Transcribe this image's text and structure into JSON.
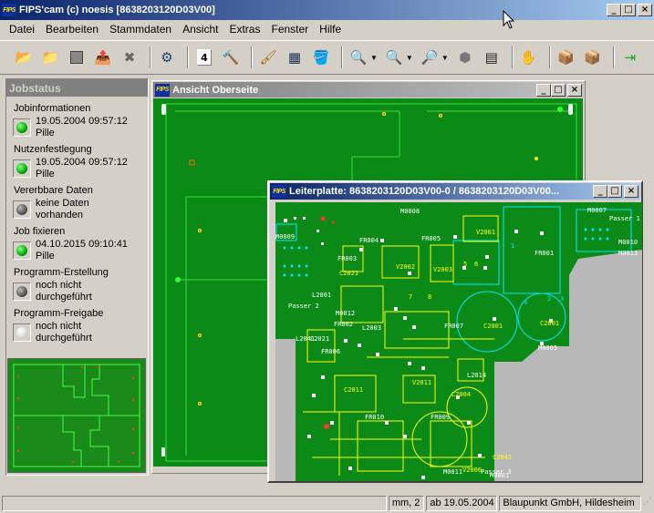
{
  "app": {
    "title": "FIPS'cam (c) noesis [8638203120D03V00]",
    "logo": "FIPS"
  },
  "menu": [
    "Datei",
    "Bearbeiten",
    "Stammdaten",
    "Ansicht",
    "Extras",
    "Fenster",
    "Hilfe"
  ],
  "toolbar": {
    "icons": [
      "open-folder-icon",
      "open-file-icon",
      "stop-icon",
      "export-icon",
      "close-document-icon",
      "camera-settings-icon",
      "calendar-icon",
      "hammer-icon",
      "brush-icon",
      "components-icon",
      "paint-bucket-icon",
      "zoom-in-icon",
      "zoom-out-icon",
      "zoom-area-icon",
      "stamp-icon",
      "chip-icon",
      "hand-icon",
      "package-icon",
      "package-open-icon",
      "exit-icon"
    ],
    "calendar_number": "4"
  },
  "jobstatus": {
    "title": "Jobstatus",
    "sections": [
      {
        "label": "Jobinformationen",
        "status": "green",
        "line1": "19.05.2004 09:57:12",
        "line2": "Pille"
      },
      {
        "label": "Nutzenfestlegung",
        "status": "green",
        "line1": "19.05.2004 09:57:12",
        "line2": "Pille"
      },
      {
        "label": "Vererbbare Daten",
        "status": "gray",
        "line1": "keine Daten",
        "line2": "vorhanden"
      },
      {
        "label": "Job fixieren",
        "status": "green",
        "line1": "04.10.2015 09:10:41",
        "line2": "Pille"
      },
      {
        "label": "Programm-Erstellung",
        "status": "gray",
        "line1": "noch nicht",
        "line2": "durchgeführt"
      },
      {
        "label": "Programm-Freigabe",
        "status": "white",
        "line1": "noch nicht",
        "line2": "durchgeführt"
      }
    ]
  },
  "view_top": {
    "title": "Ansicht Oberseite"
  },
  "pcb_window": {
    "title": "Leiterplatte: 8638203120D03V00-0 / 8638203120D03V00...",
    "labels": [
      "M0008",
      "M0007",
      "Passer 1",
      "M0009",
      "M0010",
      "M0013",
      "FR004",
      "V2001",
      "FR005",
      "V2002",
      "FR003",
      "V2003",
      "C2021",
      "FR001",
      "L2001",
      "Passer 2",
      "M0012",
      "L2003",
      "FR002",
      "FR007",
      "C2001",
      "C2001",
      "L2021",
      "M0005",
      "FR006",
      "C2011",
      "V2011",
      "L2014",
      "FR010",
      "C2004",
      "FR009",
      "C2041",
      "M0011",
      "V2006",
      "Passer 3",
      "M0001",
      "L2041"
    ],
    "pad_numbers": [
      "1",
      "2",
      "3",
      "4",
      "5",
      "6",
      "7",
      "8"
    ]
  },
  "statusbar": {
    "cells": [
      "",
      "mm, 2",
      "ab 19.05.2004",
      "Blaupunkt GmbH, Hildesheim"
    ]
  },
  "colors": {
    "board": "#0c8a18",
    "trace": "#ffff00",
    "outline": "#00e5ff",
    "panel_bg": "#d4d0c8",
    "title_active": "#0a246a"
  }
}
